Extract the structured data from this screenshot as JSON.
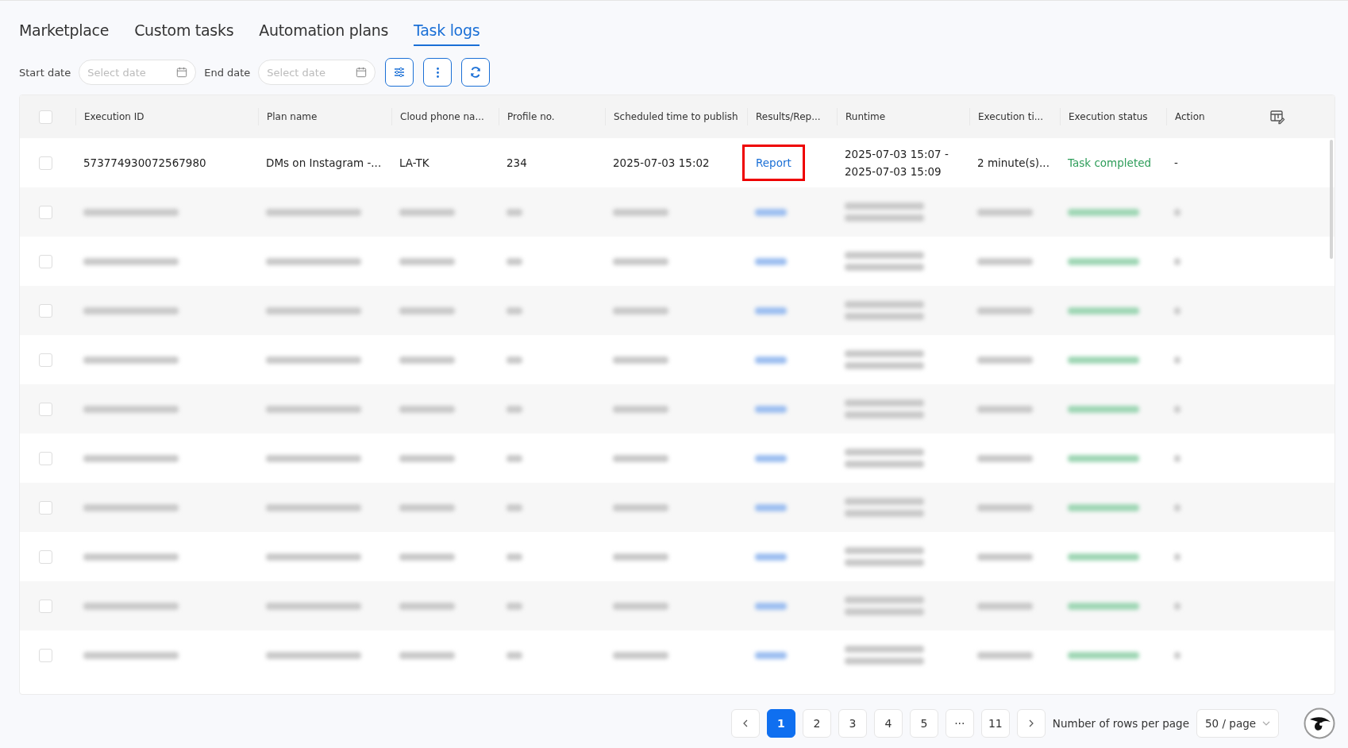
{
  "tabs": [
    {
      "label": "Marketplace",
      "selected": false
    },
    {
      "label": "Custom tasks",
      "selected": false
    },
    {
      "label": "Automation plans",
      "selected": false
    },
    {
      "label": "Task logs",
      "selected": true
    }
  ],
  "filters": {
    "start_label": "Start date",
    "start_placeholder": "Select date",
    "end_label": "End date",
    "end_placeholder": "Select date"
  },
  "table": {
    "select_all_checked": false,
    "columns": [
      "Execution ID",
      "Plan name",
      "Cloud phone na...",
      "Profile no.",
      "Scheduled time to publish",
      "Results/Rep...",
      "Runtime",
      "Execution ti...",
      "Execution status",
      "Action"
    ],
    "rows": [
      {
        "kind": "data",
        "checked": false,
        "execution_id": "573774930072567980",
        "plan_name": "DMs on Instagram -...",
        "cloud_phone": "LA-TK",
        "profile_no": "234",
        "scheduled": "2025-07-03 15:02",
        "result": "Report",
        "result_highlighted": true,
        "runtime_start": "2025-07-03 15:07 -",
        "runtime_end": "2025-07-03 15:09",
        "execution_time": "2 minute(s)...",
        "status": "Task completed",
        "action": "-"
      },
      {
        "kind": "blurred",
        "checked": false
      },
      {
        "kind": "blurred",
        "checked": false
      },
      {
        "kind": "blurred",
        "checked": false
      },
      {
        "kind": "blurred",
        "checked": false
      },
      {
        "kind": "blurred",
        "checked": false
      },
      {
        "kind": "blurred",
        "checked": false
      },
      {
        "kind": "blurred",
        "checked": false
      },
      {
        "kind": "blurred",
        "checked": false
      },
      {
        "kind": "blurred",
        "checked": false
      },
      {
        "kind": "blurred",
        "checked": false
      }
    ]
  },
  "pagination": {
    "pages": [
      {
        "label": "1",
        "selected": true
      },
      {
        "label": "2",
        "selected": false
      },
      {
        "label": "3",
        "selected": false
      },
      {
        "label": "4",
        "selected": false
      },
      {
        "label": "5",
        "selected": false
      },
      {
        "label": "···",
        "selected": false
      },
      {
        "label": "11",
        "selected": false
      }
    ],
    "rows_per_page_label": "Number of rows per page",
    "rows_per_page": "50 / page"
  }
}
